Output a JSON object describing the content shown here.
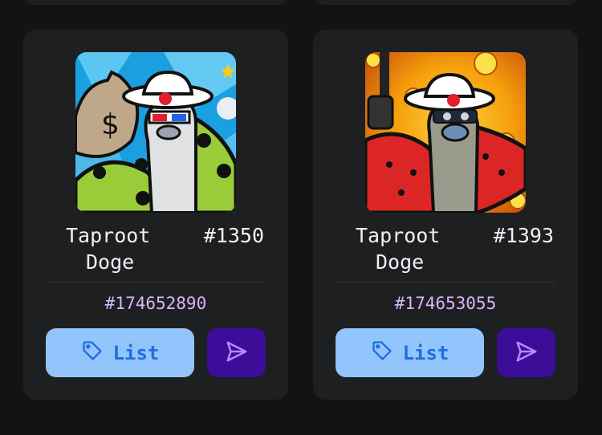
{
  "cards": [
    {
      "name_line1": "Taproot",
      "name_line2": "Doge",
      "number": "#1350",
      "inscription": "#174652890",
      "list_label": "List",
      "tag_icon": "tag-icon",
      "send_icon": "send-icon"
    },
    {
      "name_line1": "Taproot",
      "name_line2": "Doge",
      "number": "#1393",
      "inscription": "#174653055",
      "list_label": "List",
      "tag_icon": "tag-icon",
      "send_icon": "send-icon"
    }
  ],
  "colors": {
    "background": "#131314",
    "card": "#1e1f21",
    "inscription": "#d8b4fe",
    "list_button": "#93c5fd",
    "list_text": "#1d6fde",
    "send_button": "#3b0d99",
    "send_icon": "#c084fc"
  }
}
